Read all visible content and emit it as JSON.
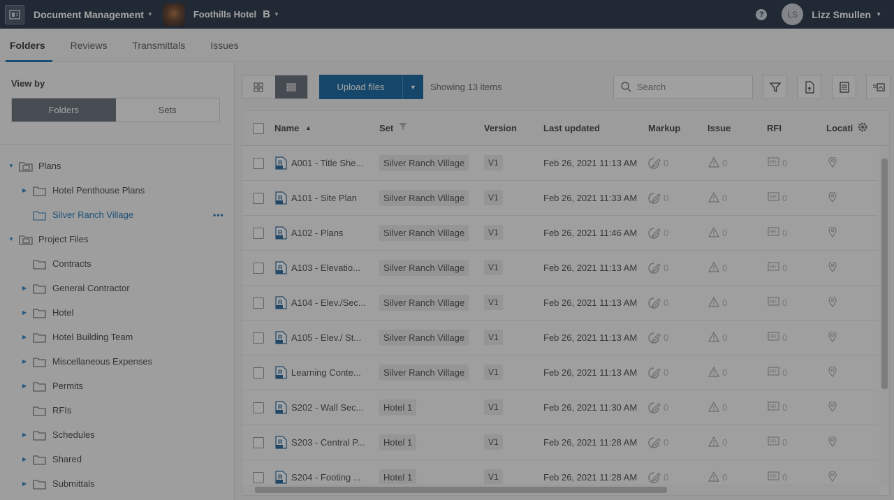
{
  "topbar": {
    "app_title": "Document Management",
    "project_name": "Foothills Hotel",
    "project_badge": "B",
    "help": "?",
    "user_initials": "LS",
    "user_name": "Lizz Smullen"
  },
  "tabs": [
    {
      "label": "Folders",
      "active": true
    },
    {
      "label": "Reviews",
      "active": false
    },
    {
      "label": "Transmittals",
      "active": false
    },
    {
      "label": "Issues",
      "active": false
    }
  ],
  "sidebar": {
    "view_by_label": "View by",
    "segments": [
      "Folders",
      "Sets"
    ],
    "tree": [
      {
        "label": "Plans",
        "level": 0,
        "expanded": true,
        "has_children": true,
        "icon": "folder-set-icon"
      },
      {
        "label": "Hotel Penthouse Plans",
        "level": 1,
        "has_children": true,
        "icon": "folder-icon"
      },
      {
        "label": "Silver Ranch Village",
        "level": 1,
        "has_children": false,
        "selected": true,
        "icon": "folder-icon"
      },
      {
        "label": "Project Files",
        "level": 0,
        "expanded": true,
        "has_children": true,
        "icon": "folder-files-icon"
      },
      {
        "label": "Contracts",
        "level": 1,
        "has_children": false,
        "icon": "folder-icon"
      },
      {
        "label": "General Contractor",
        "level": 1,
        "has_children": true,
        "icon": "folder-icon"
      },
      {
        "label": "Hotel",
        "level": 1,
        "has_children": true,
        "icon": "folder-icon"
      },
      {
        "label": "Hotel Building Team",
        "level": 1,
        "has_children": true,
        "icon": "folder-icon"
      },
      {
        "label": "Miscellaneous Expenses",
        "level": 1,
        "has_children": true,
        "icon": "folder-icon"
      },
      {
        "label": "Permits",
        "level": 1,
        "has_children": true,
        "icon": "folder-icon"
      },
      {
        "label": "RFIs",
        "level": 1,
        "has_children": false,
        "icon": "folder-icon"
      },
      {
        "label": "Schedules",
        "level": 1,
        "has_children": true,
        "icon": "folder-icon"
      },
      {
        "label": "Shared",
        "level": 1,
        "has_children": true,
        "icon": "folder-icon"
      },
      {
        "label": "Submittals",
        "level": 1,
        "has_children": true,
        "icon": "folder-icon"
      }
    ]
  },
  "toolbar": {
    "upload_label": "Upload files",
    "showing": "Showing 13 items",
    "search_placeholder": "Search"
  },
  "table": {
    "columns": [
      "Name",
      "Set",
      "Version",
      "Last updated",
      "Markup",
      "Issue",
      "RFI",
      "Locati"
    ],
    "rows": [
      {
        "name": "A001 - Title She...",
        "set": "Silver Ranch Village",
        "version": "V1",
        "updated": "Feb 26, 2021 11:13 AM",
        "markup": "0",
        "issue": "0",
        "rfi": "0"
      },
      {
        "name": "A101 - Site Plan",
        "set": "Silver Ranch Village",
        "version": "V1",
        "updated": "Feb 26, 2021 11:33 AM",
        "markup": "0",
        "issue": "0",
        "rfi": "0"
      },
      {
        "name": "A102 - Plans",
        "set": "Silver Ranch Village",
        "version": "V1",
        "updated": "Feb 26, 2021 11:46 AM",
        "markup": "0",
        "issue": "0",
        "rfi": "0"
      },
      {
        "name": "A103 - Elevatio...",
        "set": "Silver Ranch Village",
        "version": "V1",
        "updated": "Feb 26, 2021 11:13 AM",
        "markup": "0",
        "issue": "0",
        "rfi": "0"
      },
      {
        "name": "A104 - Elev./Sec...",
        "set": "Silver Ranch Village",
        "version": "V1",
        "updated": "Feb 26, 2021 11:13 AM",
        "markup": "0",
        "issue": "0",
        "rfi": "0"
      },
      {
        "name": "A105 - Elev./ St...",
        "set": "Silver Ranch Village",
        "version": "V1",
        "updated": "Feb 26, 2021 11:13 AM",
        "markup": "0",
        "issue": "0",
        "rfi": "0"
      },
      {
        "name": "Learning Conte...",
        "set": "Silver Ranch Village",
        "version": "V1",
        "updated": "Feb 26, 2021 11:13 AM",
        "markup": "0",
        "issue": "0",
        "rfi": "0"
      },
      {
        "name": "S202 - Wall Sec...",
        "set": "Hotel 1",
        "version": "V1",
        "updated": "Feb 26, 2021 11:30 AM",
        "markup": "0",
        "issue": "0",
        "rfi": "0"
      },
      {
        "name": "S203 - Central P...",
        "set": "Hotel 1",
        "version": "V1",
        "updated": "Feb 26, 2021 11:28 AM",
        "markup": "0",
        "issue": "0",
        "rfi": "0"
      },
      {
        "name": "S204 - Footing ...",
        "set": "Hotel 1",
        "version": "V1",
        "updated": "Feb 26, 2021 11:28 AM",
        "markup": "0",
        "issue": "0",
        "rfi": "0"
      }
    ]
  },
  "colors": {
    "topbar": "#1b2a3d",
    "accent": "#0a5e99",
    "selected_text": "#1670b3"
  }
}
